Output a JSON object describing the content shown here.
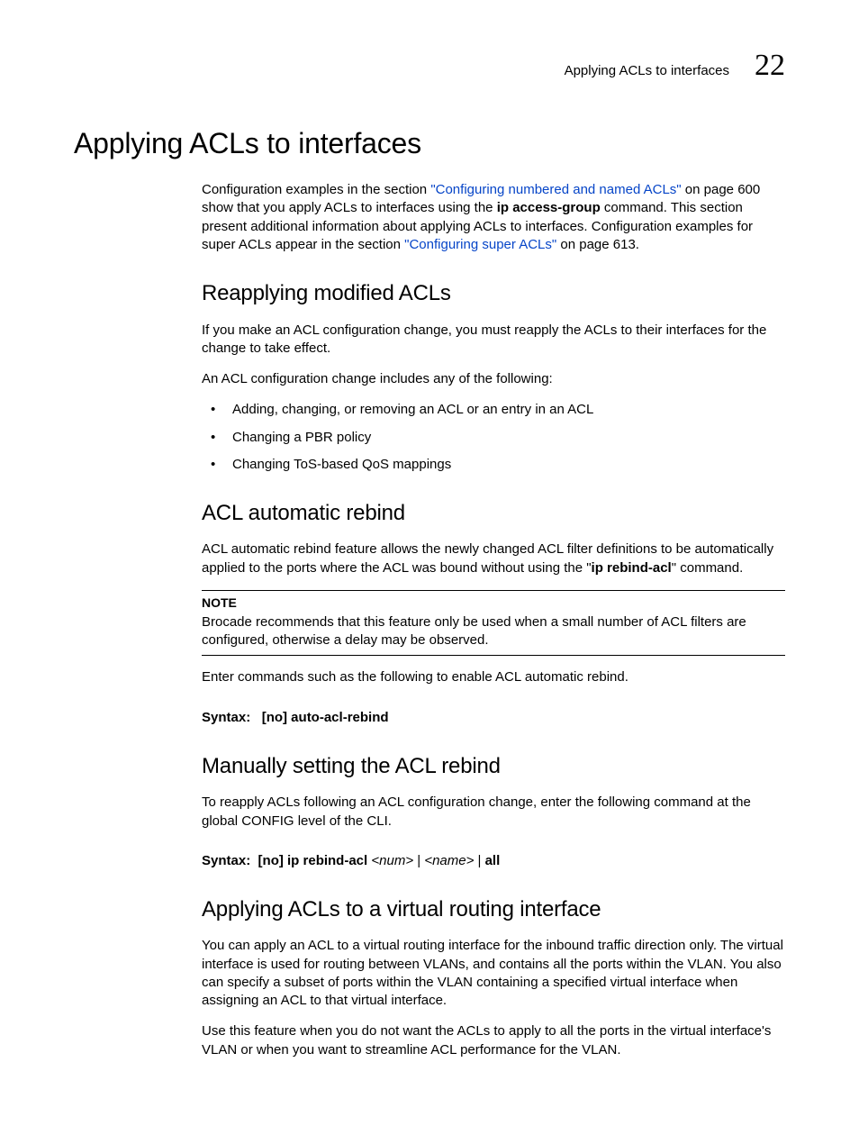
{
  "header": {
    "running_title": "Applying ACLs to interfaces",
    "chapter_number": "22"
  },
  "title": "Applying ACLs to interfaces",
  "intro": {
    "pre1": "Configuration examples in the section ",
    "link1": "\"Configuring numbered and named ACLs\"",
    "post1": " on page 600 show that you apply ACLs to interfaces using the ",
    "cmd1": "ip access-group",
    "post1b": " command. This section present additional information about applying ACLs to interfaces. Configuration examples for super ACLs appear in the section ",
    "link2": "\"Configuring super ACLs\"",
    "post2": " on page 613."
  },
  "s1": {
    "heading": "Reapplying modified ACLs",
    "p1": "If you make an ACL configuration change, you must reapply the ACLs to their interfaces for the change to take effect.",
    "p2": "An ACL configuration change includes any of the following:",
    "bullets": [
      "Adding, changing, or removing an ACL or an entry in an ACL",
      "Changing a PBR policy",
      "Changing ToS-based QoS mappings"
    ]
  },
  "s2": {
    "heading": "ACL automatic rebind",
    "p1a": "ACL automatic rebind feature allows the newly changed ACL filter definitions to be automatically applied to the ports where the ACL was bound without using the \"",
    "cmd": "ip rebind-acl",
    "p1b": "\" command.",
    "note_label": "NOTE",
    "note_body": "Brocade recommends that this feature only be used when a small number of ACL filters  are configured, otherwise  a delay may be observed.",
    "p2": "Enter commands such as the following to enable ACL automatic rebind.",
    "syntax_label": "Syntax:",
    "syntax_body": "[no] auto-acl-rebind"
  },
  "s3": {
    "heading": "Manually setting the ACL rebind",
    "p1": "To reapply ACLs following an ACL configuration change, enter the following command at the global CONFIG level of the CLI.",
    "syntax_label": "Syntax:",
    "syntax_pre": "[no] ip rebind-acl ",
    "syntax_arg1": "<num>",
    "syntax_mid": " | ",
    "syntax_arg2": "<name>",
    "syntax_post": " | ",
    "syntax_all": "all"
  },
  "s4": {
    "heading": "Applying ACLs to a virtual routing interface",
    "p1": "You can apply an ACL to a virtual routing interface for the inbound traffic direction only. The virtual interface is used for routing between VLANs, and contains all the ports within the VLAN. You also can specify a subset of ports within the VLAN containing a specified virtual interface when assigning an ACL to that virtual interface.",
    "p2": "Use this feature when you do not want the ACLs to apply to all the ports in the virtual interface's VLAN or when you want to streamline ACL performance for the VLAN."
  }
}
